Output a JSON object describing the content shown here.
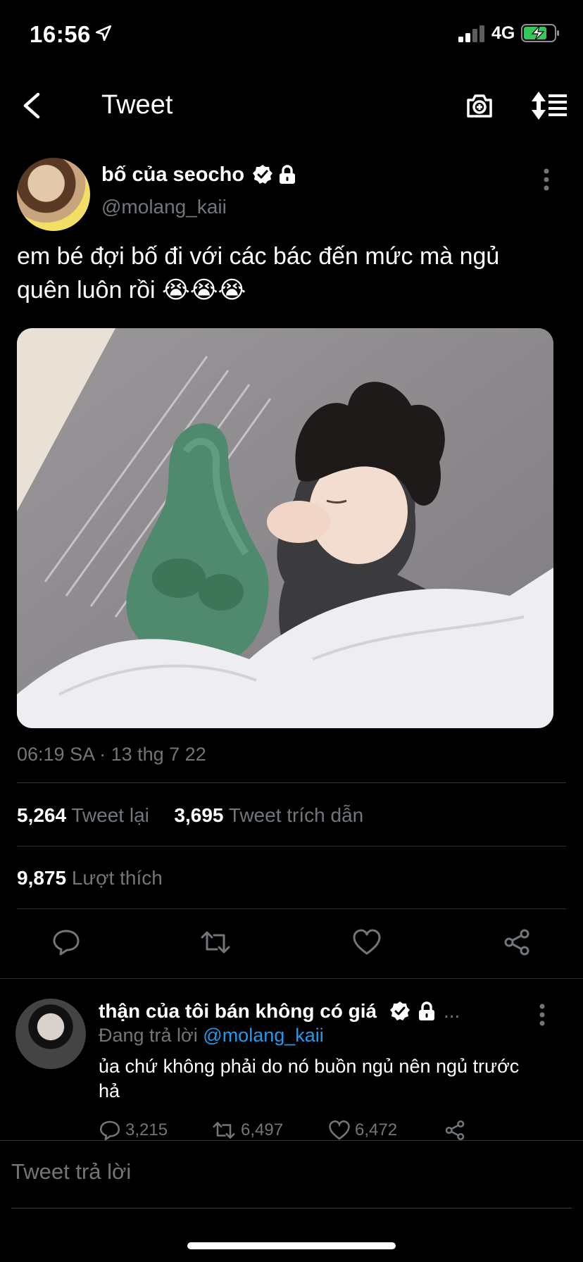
{
  "status_bar": {
    "time": "16:56",
    "network": "4G"
  },
  "nav": {
    "title": "Tweet"
  },
  "tweet": {
    "author_name": "bố của seocho",
    "author_handle": "@molang_kaii",
    "text": "em bé đợi bố đi với các bác đến mức mà ngủ quên luôn rồi 😭😭😭",
    "timestamp": "06:19 SA · 13 thg 7 22",
    "retweets": "5,264",
    "retweets_label": "Tweet lại",
    "quotes": "3,695",
    "quotes_label": "Tweet trích dẫn",
    "likes": "9,875",
    "likes_label": "Lượt thích"
  },
  "reply": {
    "author_name": "thận của tôi bán không có giá",
    "ellipsis": "...",
    "replying_prefix": "Đang trả lời",
    "replying_handle": "@molang_kaii",
    "text": "ủa chứ không phải do nó buồn ngủ nên ngủ trước hả",
    "reply_count": "3,215",
    "retweet_count": "6,497",
    "like_count": "6,472"
  },
  "composer": {
    "placeholder": "Tweet trả lời"
  },
  "colors": {
    "accent": "#1d9bf0",
    "muted": "#71767b",
    "battery": "#34c759"
  }
}
